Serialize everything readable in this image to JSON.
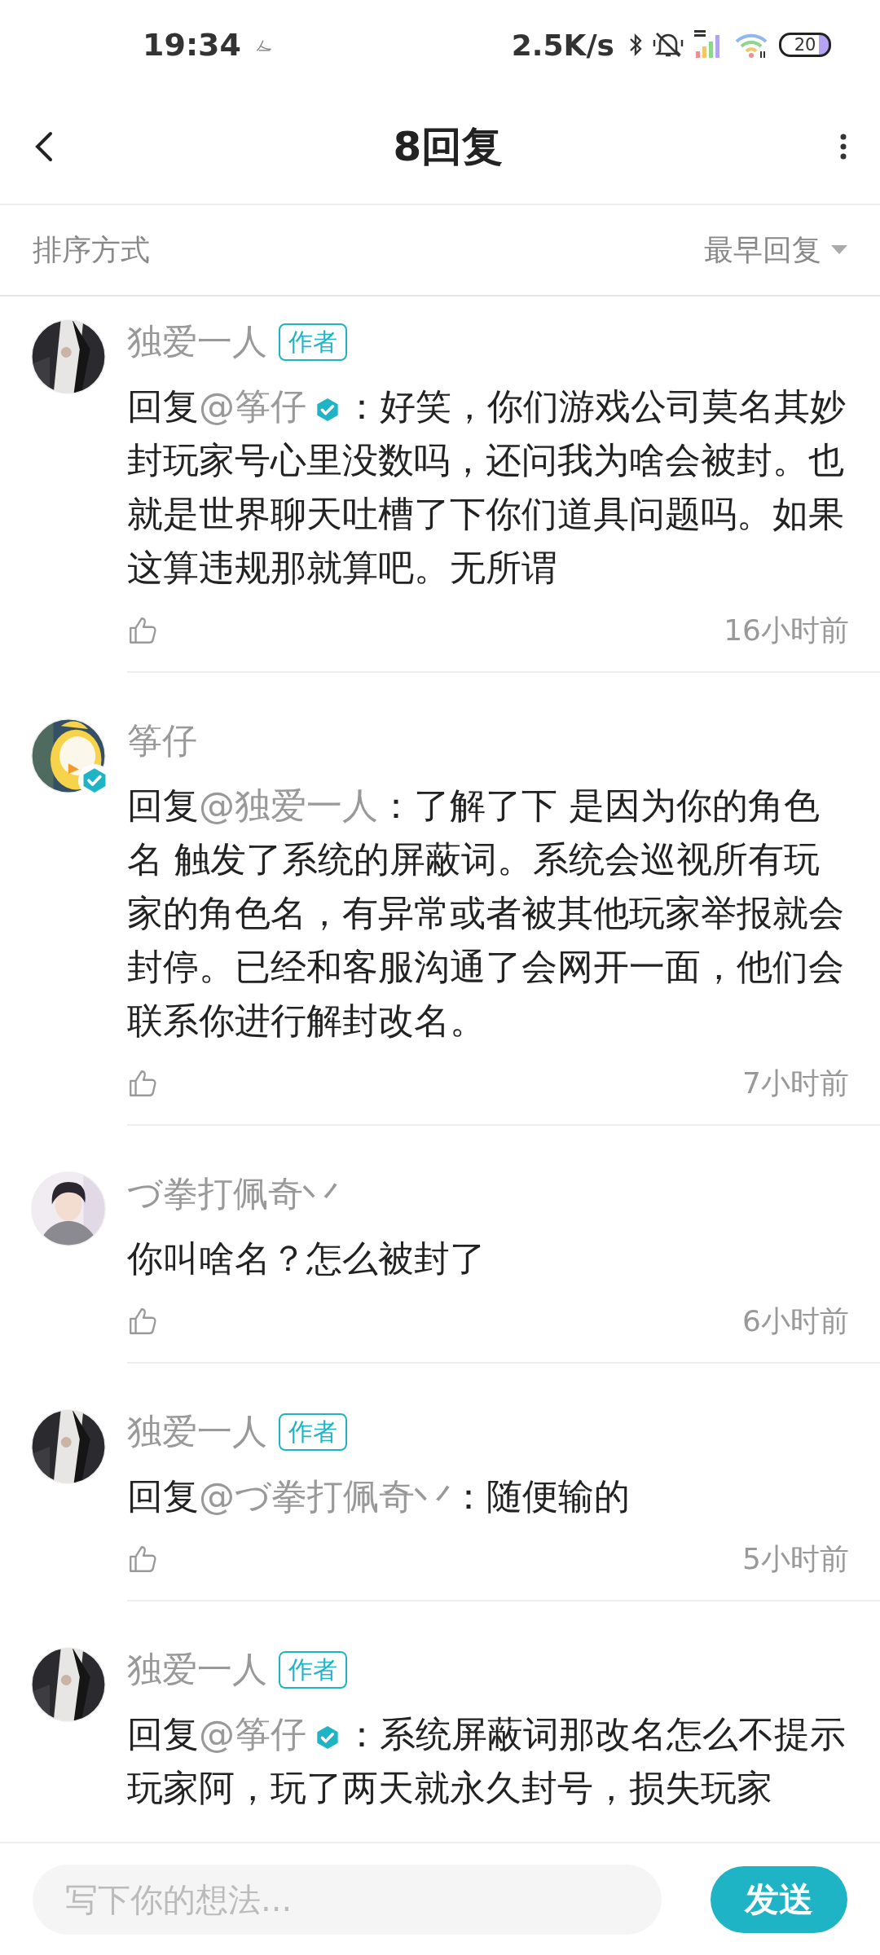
{
  "status_bar": {
    "time": "19:34",
    "network_speed": "2.5K/s",
    "battery": "20"
  },
  "header": {
    "title": "8回复"
  },
  "sort": {
    "label": "排序方式",
    "value": "最早回复"
  },
  "comments": [
    {
      "author": "独爱一人",
      "author_badge": "作者",
      "avatar_verified": false,
      "reply_prefix": "回复",
      "reply_to": "@筝仔",
      "reply_to_verified": true,
      "text": "：好笑，你们游戏公司莫名其妙封玩家号心里没数吗，还问我为啥会被封。也就是世界聊天吐槽了下你们道具问题吗。如果这算违规那就算吧。无所谓",
      "time": "16小时前"
    },
    {
      "author": "筝仔",
      "avatar_verified": true,
      "reply_prefix": "回复",
      "reply_to": "@独爱一人",
      "reply_to_verified": false,
      "text": "：了解了下 是因为你的角色名 触发了系统的屏蔽词。系统会巡视所有玩家的角色名，有异常或者被其他玩家举报就会封停。已经和客服沟通了会网开一面，他们会联系你进行解封改名。",
      "time": "7小时前"
    },
    {
      "author": "づ拳打佩奇丷",
      "avatar_verified": false,
      "text": "你叫啥名？怎么被封了",
      "time": "6小时前"
    },
    {
      "author": "独爱一人",
      "author_badge": "作者",
      "avatar_verified": false,
      "reply_prefix": "回复",
      "reply_to": "@づ拳打佩奇丷",
      "reply_to_verified": false,
      "text": "：随便输的",
      "time": "5小时前"
    },
    {
      "author": "独爱一人",
      "author_badge": "作者",
      "avatar_verified": false,
      "reply_prefix": "回复",
      "reply_to": "@筝仔",
      "reply_to_verified": true,
      "text": "：系统屏蔽词那改名怎么不提示玩家阿，玩了两天就永久封号，损失玩家"
    }
  ],
  "composer": {
    "placeholder": "写下你的想法...",
    "send": "发送"
  }
}
